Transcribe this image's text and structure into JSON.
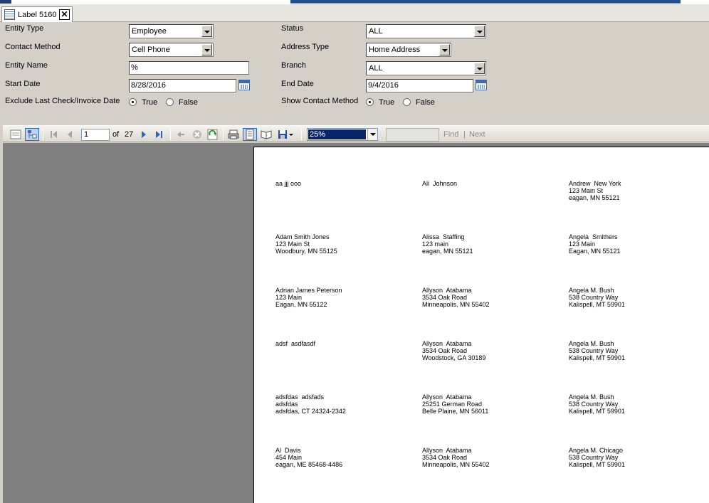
{
  "tab": {
    "title": "Label 5160",
    "close": "✕"
  },
  "params": {
    "entity_type": {
      "label": "Entity Type",
      "value": "Employee"
    },
    "contact_method": {
      "label": "Contact Method",
      "value": "Cell Phone"
    },
    "entity_name": {
      "label": "Entity Name",
      "value": "%"
    },
    "start_date": {
      "label": "Start Date",
      "value": "8/28/2016"
    },
    "exclude_last": {
      "label": "Exclude Last Check/Invoice Date",
      "true_label": "True",
      "false_label": "False",
      "selected": "True"
    },
    "status": {
      "label": "Status",
      "value": "ALL"
    },
    "address_type": {
      "label": "Address Type",
      "value": "Home Address"
    },
    "branch": {
      "label": "Branch",
      "value": "ALL"
    },
    "end_date": {
      "label": "End Date",
      "value": "9/4/2016"
    },
    "show_contact": {
      "label": "Show Contact Method",
      "true_label": "True",
      "false_label": "False",
      "selected": "True"
    }
  },
  "toolbar": {
    "page_value": "1",
    "page_of": "of",
    "page_total": "27",
    "zoom": "25%",
    "find": "Find",
    "separator": "|",
    "next": "Next"
  },
  "labels": [
    [
      "aa jjj ooo",
      "Ali  Johnson",
      "Andrew  New York\n123 Main St\neagan, MN 55121"
    ],
    [
      "Adam Smith Jones\n123 Main St\nWoodbury, MN 55125",
      "Alissa  Staffing\n123 main\neagan, MN 55121",
      "Angela  Smithers\n123 Main\nEagan, MN 55121"
    ],
    [
      "Adrian James Peterson\n123 Main\nEagan, MN 55122",
      "Allyson  Atabama\n3534 Oak Road\nMinneapolis, MN 55402",
      "Angela M. Bush\n538 Country Way\nKalispell, MT 59901"
    ],
    [
      "adsf  asdfasdf",
      "Allyson  Atabama\n3534 Oak Road\nWoodstock, GA 30189",
      "Angela M. Bush\n538 Country Way\nKalispell, MT 59901"
    ],
    [
      "adsfdas  adsfads\nadsfdas\nadsfdas, CT 24324-2342",
      "Allyson  Atabama\n25251 German Road\nBelle Plaine, MN 56011",
      "Angela M. Bush\n538 Country Way\nKalispell, MT 59901"
    ],
    [
      "Al  Davis\n454 Main\neagan, ME 85468-4486",
      "Allyson  Atabama\n3534 Oak Road\nMinneapolis, MN 55402",
      "Angela M. Chicago\n538 Country Way\nKalispell, MT 59901"
    ]
  ]
}
